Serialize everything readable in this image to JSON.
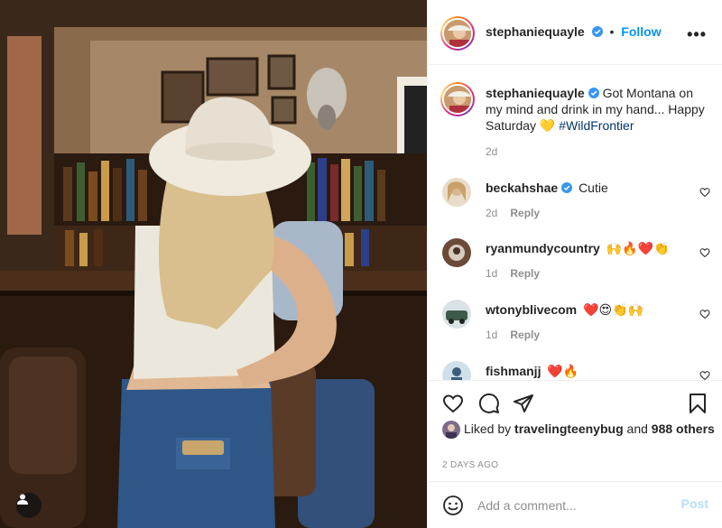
{
  "post": {
    "author": "stephaniequayle",
    "follow_label": "Follow",
    "separator": "•",
    "more_label": "•••"
  },
  "caption": {
    "username": "stephaniequayle",
    "text": "Got Montana on my mind and drink in my hand... Happy Saturday 💛",
    "hashtag": "#WildFrontier",
    "age": "2d"
  },
  "comments": [
    {
      "username": "beckahshae",
      "verified": true,
      "text": "Cutie",
      "age": "2d",
      "reply_label": "Reply"
    },
    {
      "username": "ryanmundycountry",
      "verified": false,
      "text": "🙌🔥❤️👏",
      "age": "1d",
      "reply_label": "Reply"
    },
    {
      "username": "wtonyblivecom",
      "verified": false,
      "text": "❤️😍👏🙌",
      "age": "1d",
      "reply_label": "Reply"
    },
    {
      "username": "fishmanjj",
      "verified": false,
      "text": "❤️🔥",
      "age": "",
      "reply_label": ""
    }
  ],
  "likes": {
    "prefix": "Liked by",
    "user": "travelingteenybug",
    "conj": "and",
    "others": "988 others"
  },
  "timestamp": "2 DAYS AGO",
  "add_comment": {
    "placeholder": "Add a comment...",
    "post_label": "Post"
  },
  "icons": {
    "verified": "verified-badge-icon",
    "heart": "heart-icon",
    "comment": "comment-icon",
    "share": "share-icon",
    "save": "bookmark-icon",
    "emoji": "emoji-icon",
    "user_tag": "user-tag-icon"
  },
  "colors": {
    "accent": "#0095f6",
    "verified": "#3897f0",
    "hashtag": "#00376b",
    "muted": "#8e8e8e",
    "post_disabled": "#b2dffc"
  }
}
